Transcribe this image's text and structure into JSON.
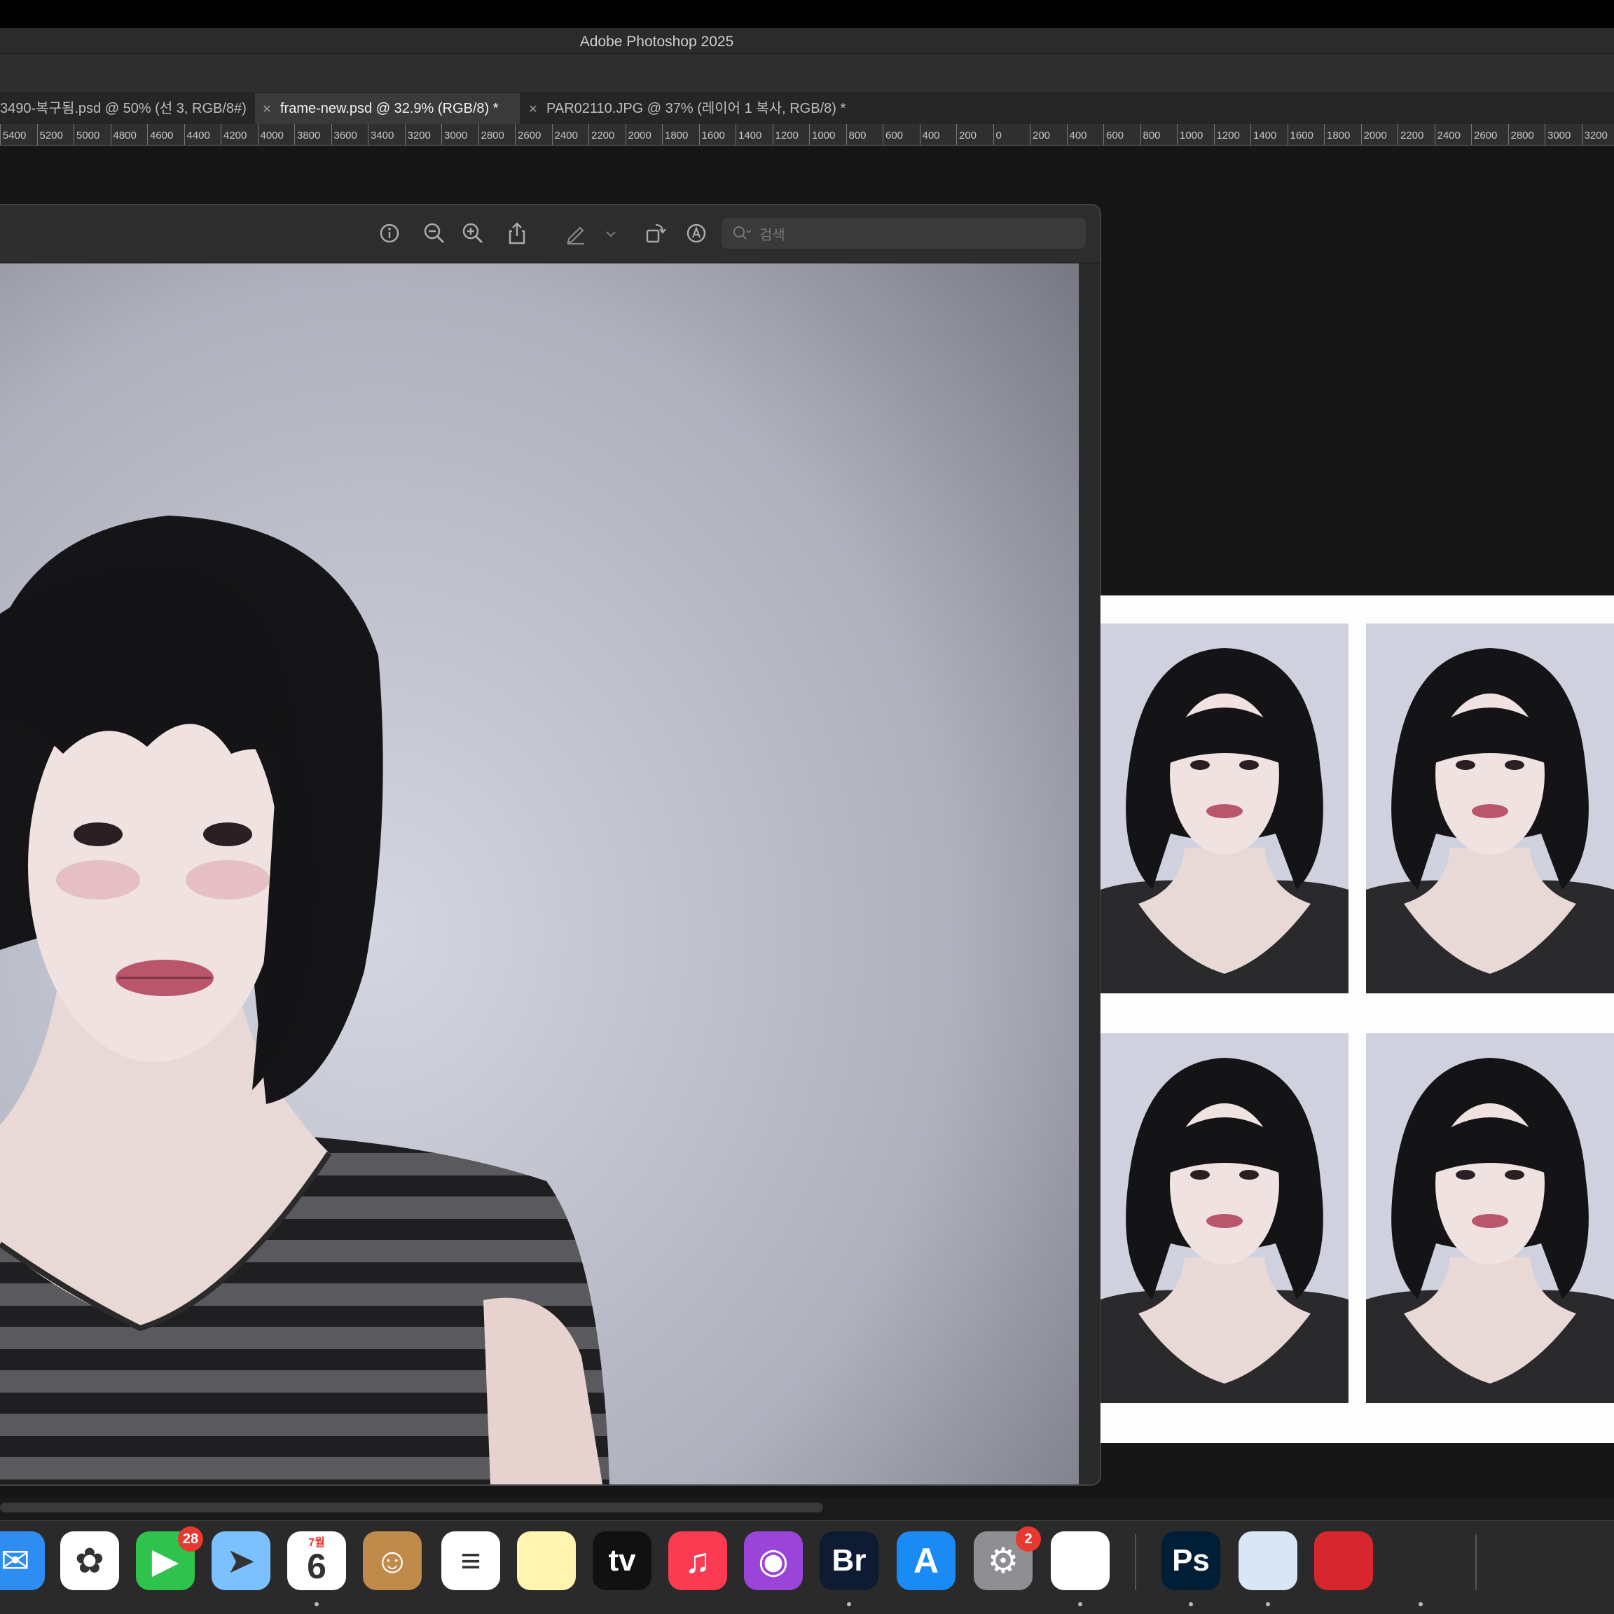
{
  "app": {
    "title": "Adobe Photoshop 2025"
  },
  "tabs": [
    {
      "label": "3490-복구됨.psd @ 50% (선 3, RGB/8#)",
      "active": false
    },
    {
      "label": "frame-new.psd @ 32.9% (RGB/8) *",
      "active": true
    },
    {
      "label": "PAR02110.JPG @ 37% (레이어 1 복사, RGB/8) *",
      "active": false
    }
  ],
  "ruler": {
    "ticks": [
      "5400",
      "5200",
      "5000",
      "4800",
      "4600",
      "4400",
      "4200",
      "4000",
      "3800",
      "3600",
      "3400",
      "3200",
      "3000",
      "2800",
      "2600",
      "2400",
      "2200",
      "2000",
      "1800",
      "1600",
      "1400",
      "1200",
      "1000",
      "800",
      "600",
      "400",
      "200",
      "0",
      "200",
      "400",
      "600",
      "800",
      "1000",
      "1200",
      "1400",
      "1600",
      "1800",
      "2000",
      "2200",
      "2400",
      "2600",
      "2800",
      "3000",
      "3200"
    ]
  },
  "preview": {
    "toolbar_icons": [
      "info-icon",
      "zoom-out-icon",
      "zoom-in-icon",
      "share-icon",
      "markup-icon",
      "chevron-down-icon",
      "rotate-icon",
      "annotate-icon"
    ],
    "search_placeholder": "검색"
  },
  "dock": {
    "items": [
      {
        "name": "mail",
        "label": "✉",
        "bg": "#2f8cf0"
      },
      {
        "name": "photos",
        "label": "✿",
        "bg": "#ffffff"
      },
      {
        "name": "facetime",
        "label": "▶",
        "bg": "#2fc24c",
        "badge": "28"
      },
      {
        "name": "maps",
        "label": "➤",
        "bg": "#7cc1ff"
      },
      {
        "name": "calendar",
        "label": "6",
        "sub": "7월",
        "bg": "#ffffff"
      },
      {
        "name": "contacts",
        "label": "☺",
        "bg": "#c08a4a"
      },
      {
        "name": "reminders",
        "label": "≡",
        "bg": "#ffffff"
      },
      {
        "name": "notes",
        "label": "",
        "bg": "#fff5b0"
      },
      {
        "name": "apple-tv",
        "label": "tv",
        "bg": "#111111"
      },
      {
        "name": "music",
        "label": "♫",
        "bg": "#fb3b52"
      },
      {
        "name": "podcasts",
        "label": "◉",
        "bg": "#9b45d8"
      },
      {
        "name": "bridge",
        "label": "Br",
        "bg": "#0d1c33"
      },
      {
        "name": "app-store",
        "label": "A",
        "bg": "#1a8bf5"
      },
      {
        "name": "system-settings",
        "label": "⚙",
        "bg": "#8e8e93",
        "badge": "2"
      },
      {
        "name": "chrome",
        "label": "",
        "bg": "#ffffff"
      },
      {
        "name": "photoshop",
        "label": "Ps",
        "bg": "#001e36"
      },
      {
        "name": "preview",
        "label": "",
        "bg": "#d8e6f5"
      },
      {
        "name": "photo-booth",
        "label": "",
        "bg": "#d7262e"
      },
      {
        "name": "printer",
        "label": "",
        "bg": "#2a2a2a"
      },
      {
        "name": "print-queue",
        "label": "",
        "bg": "#2a2a2a"
      },
      {
        "name": "trash",
        "label": "",
        "bg": "#2a2a2a"
      }
    ]
  }
}
